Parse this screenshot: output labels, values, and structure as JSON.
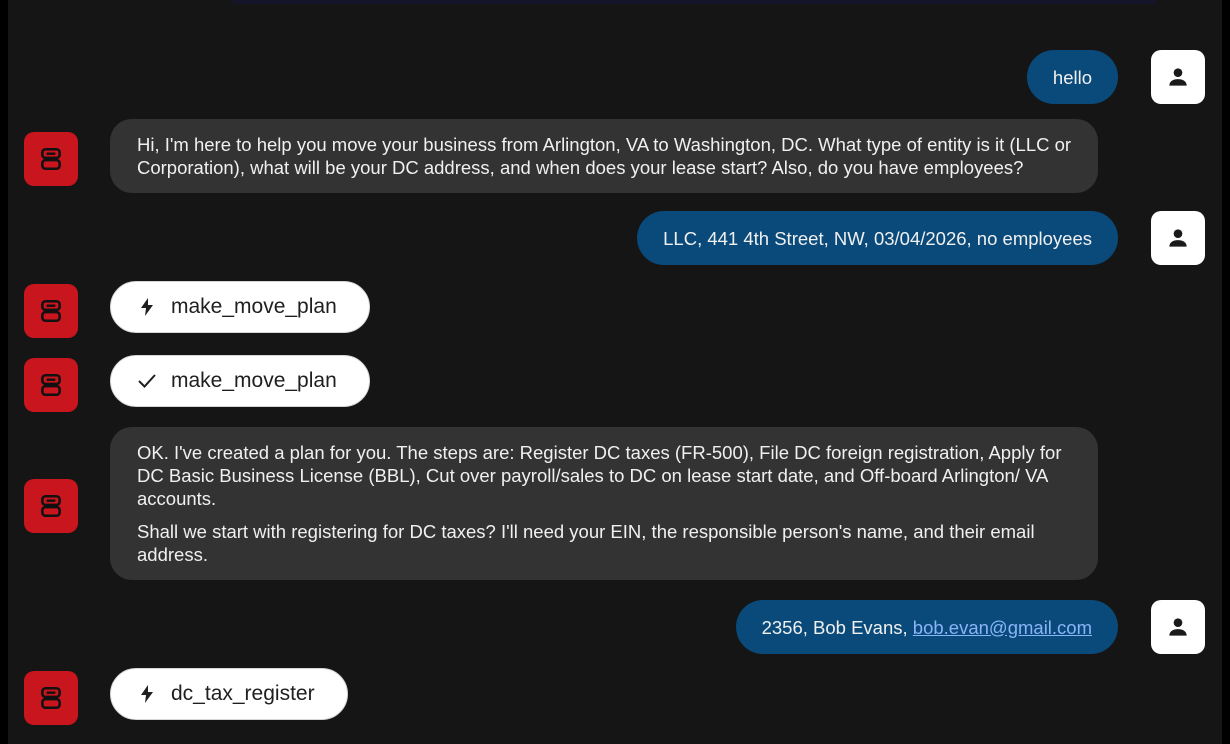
{
  "messages": {
    "m1": {
      "role": "user",
      "text": "hello"
    },
    "m2": {
      "role": "bot",
      "text": "Hi, I'm here to help you move your business from Arlington, VA to Washington, DC. What type of entity is it (LLC or Corporation), what will be your DC address, and when does your lease start? Also, do you have employees?"
    },
    "m3": {
      "role": "user",
      "text": "LLC, 441 4th Street, NW, 03/04/2026, no employees"
    },
    "m4": {
      "role": "tool",
      "status": "running",
      "icon": "bolt-icon",
      "label": "make_move_plan"
    },
    "m5": {
      "role": "tool",
      "status": "done",
      "icon": "check-icon",
      "label": "make_move_plan"
    },
    "m6": {
      "role": "bot",
      "p1": "OK. I've created a plan for you. The steps are: Register DC taxes (FR-500), File DC foreign registration, Apply for DC Basic Business License (BBL), Cut over payroll/sales to DC on lease start date, and Off-board Arlington/ VA accounts.",
      "p2": "Shall we start with registering for DC taxes? I'll need your EIN, the responsible person's name, and their email address."
    },
    "m7": {
      "role": "user",
      "text_prefix": "2356, Bob Evans, ",
      "email": "bob.evan@gmail.com"
    },
    "m8": {
      "role": "tool",
      "status": "running",
      "icon": "bolt-icon",
      "label": "dc_tax_register"
    }
  },
  "colors": {
    "user_bubble": "#0a4a7a",
    "bot_bubble": "#333333",
    "bot_avatar": "#c9151d",
    "user_avatar": "#ffffff",
    "link": "#8ab4f8"
  }
}
